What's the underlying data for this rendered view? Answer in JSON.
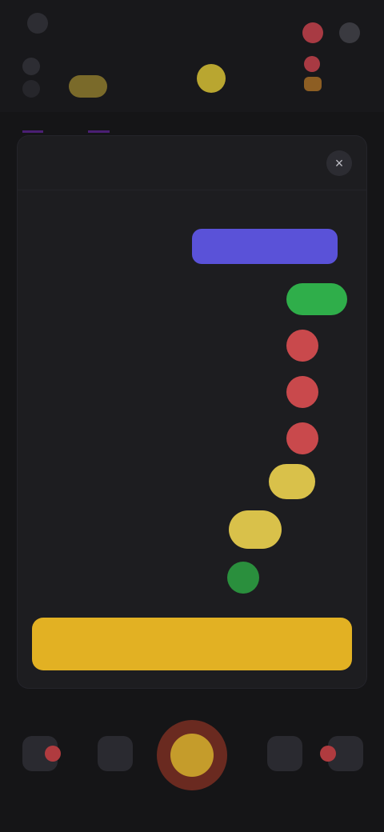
{
  "header": {
    "player_name": "",
    "coin_chip": "",
    "tabs": [
      "",
      ""
    ]
  },
  "modal": {
    "title": "",
    "close_glyph": "×",
    "rows": [
      {
        "label": "",
        "sub": "",
        "value": ""
      },
      {
        "label": "",
        "value": ""
      },
      {
        "label": "",
        "value": ""
      },
      {
        "label": "",
        "value": ""
      },
      {
        "label": "",
        "value": ""
      },
      {
        "label": "",
        "value": ""
      },
      {
        "label": "",
        "value": ""
      },
      {
        "label": "",
        "value": ""
      }
    ],
    "primary_button": ""
  },
  "bottom_nav": {
    "items": [
      "",
      "",
      "",
      "",
      ""
    ]
  },
  "colors": {
    "accent_purple": "#5a52d8",
    "accent_yellow": "#e2b123",
    "status_green": "#2fae4a",
    "status_red": "#c9494c",
    "status_yellow": "#d9c14a",
    "background": "#151517"
  },
  "icons": [
    "menu-icon",
    "avatar-icon",
    "notification-icon",
    "settings-icon",
    "coin-icon",
    "close-icon",
    "home-icon",
    "shop-icon",
    "play-icon",
    "friends-icon",
    "profile-icon"
  ]
}
